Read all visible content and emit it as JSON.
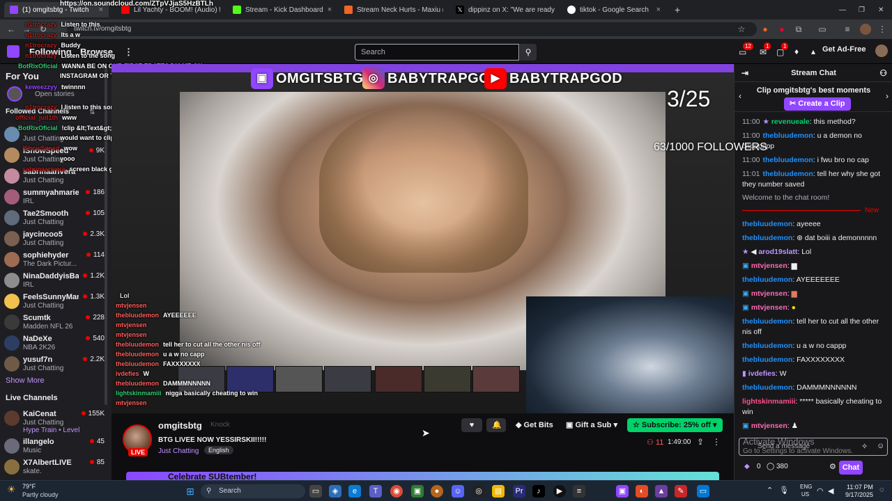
{
  "browser": {
    "tabs": [
      {
        "label": "(1) omgitsbtg - Twitch",
        "color": "#9146ff"
      },
      {
        "label": "Lil Yachty - BOOM! (Audio) ft. U",
        "color": "#ff0000"
      },
      {
        "label": "Stream - Kick Dashboard",
        "color": "#53fc18"
      },
      {
        "label": "Stream Neck Hurts - Maxiu (re",
        "color": "#f26522"
      },
      {
        "label": "dippinz on X: \"We are ready to",
        "color": "#ffffff"
      },
      {
        "label": "tiktok - Google Search",
        "color": "#4285f4"
      }
    ],
    "url": "twitch.tv/omgitsbtg",
    "new_tab": "+",
    "close": "×"
  },
  "topnav": {
    "following": "Following",
    "browse": "Browse",
    "search_placeholder": "Search",
    "notif_count_1": "12",
    "notif_count_2": "1",
    "notif_count_3": "1",
    "get_ad_free": "Get Ad-Free"
  },
  "sidebar": {
    "for_you": "For You",
    "open_stories": "Open stories",
    "followed_channels": "Followed Channels",
    "followed": [
      {
        "name": "",
        "category": "Just Chatting",
        "viewers": "",
        "color": "#6a8caf"
      },
      {
        "name": "IShowSpeed",
        "category": "Just Chatting",
        "viewers": "9K",
        "color": "#b58a5e"
      },
      {
        "name": "sabrinaarivera",
        "category": "Just Chatting",
        "viewers": "",
        "color": "#c48b9f"
      },
      {
        "name": "summyahmarie",
        "category": "IRL",
        "viewers": "186",
        "color": "#a35c7a"
      },
      {
        "name": "Tae2Smooth",
        "category": "Just Chatting",
        "viewers": "105",
        "color": "#5f6b7a"
      },
      {
        "name": "jaycincoo5",
        "category": "Just Chatting",
        "viewers": "2.3K",
        "color": "#7a6050"
      },
      {
        "name": "sophiehyder",
        "category": "The Dark Pictur...",
        "viewers": "114",
        "color": "#9e6b53"
      },
      {
        "name": "NinaDaddyisBa...",
        "category": "IRL",
        "viewers": "1.2K",
        "color": "#8d8d8d"
      },
      {
        "name": "FeelsSunnyMan",
        "category": "Just Chatting",
        "viewers": "1.3K",
        "color": "#f2c14e"
      },
      {
        "name": "Scumtk",
        "category": "Madden NFL 26",
        "viewers": "228",
        "color": "#3a3a3a"
      },
      {
        "name": "NaDeXe",
        "category": "NBA 2K26",
        "viewers": "540",
        "color": "#2d3e63"
      },
      {
        "name": "yusuf7n",
        "category": "Just Chatting",
        "viewers": "2.2K",
        "color": "#6f5a48"
      }
    ],
    "show_more": "Show More",
    "live_channels": "Live Channels",
    "live": [
      {
        "name": "KaiCenat",
        "category": "Just Chatting",
        "extra": "Hype Train • Level 22",
        "viewers": "155K",
        "color": "#5c3b2e"
      },
      {
        "name": "illangelo",
        "category": "Music",
        "extra": "",
        "viewers": "45",
        "color": "#6a6a7a"
      },
      {
        "name": "X7AlbertLIVE",
        "category": "skate.",
        "extra": "",
        "viewers": "85",
        "color": "#8a6f3e"
      }
    ]
  },
  "overlay_chat": {
    "soundcloud": "https://on.soundcloud.com/ZTpVJjaS5HzBTLh",
    "lines": [
      {
        "user": "n1trocrazy",
        "text": "Listen to this"
      },
      {
        "user": "n1trocrazy",
        "text": "Its a w"
      },
      {
        "user": "n1trocrazy",
        "text": "Buddy"
      },
      {
        "user": "n1trocrazy",
        "text": "Listen to the song"
      },
      {
        "user": "BotRixOficial",
        "text": "WANNA BE ON OUR FIRST EDATE? DM ME ON"
      },
      {
        "user": "",
        "text": "INSTAGRAM OR TWITTER !instagram !twitter"
      },
      {
        "user": "keweezzyy",
        "text": "twinnnn"
      },
      {
        "user": "n1trocrazy",
        "text": "I listen to this song everyday"
      },
      {
        "user": "official_jud1th",
        "text": "www"
      },
      {
        "user": "BotRixOficial",
        "text": "!clip &lt;Text&gt; then the number of seconds you"
      },
      {
        "user": "",
        "text": "would want to clip after"
      },
      {
        "user": "IShowSpeed",
        "text": "wow"
      },
      {
        "user": "",
        "text": "yooo"
      },
      {
        "user": "sabrinaarivera",
        "text": "screen black gang"
      }
    ]
  },
  "video": {
    "banner_twitch": "OMGITSBTG",
    "banner_ig": "BABYTRAPGOD",
    "banner_yt": "BABYTRAPGOD",
    "counter": "3/25",
    "followers_goal": "63/1000 FOLLOWERS",
    "mini_chat": [
      {
        "user": "",
        "text": "Lol",
        "color": "#9146ff"
      },
      {
        "user": "mtvjensen",
        "text": "",
        "color": "#ff5c5c"
      },
      {
        "user": "thebluudemon",
        "text": "AYEEEEEE",
        "color": "#ff5c5c"
      },
      {
        "user": "mtvjensen",
        "text": "",
        "color": "#ff5c5c"
      },
      {
        "user": "mtvjensen",
        "text": "",
        "color": "#ff5c5c"
      },
      {
        "user": "thebluudemon",
        "text": "tell her to cut all the other nis off",
        "color": "#ff5c5c"
      },
      {
        "user": "thebluudemon",
        "text": "u a w no capp",
        "color": "#ff5c5c"
      },
      {
        "user": "thebluudemon",
        "text": "FAXXXXXXX",
        "color": "#ff5c5c"
      },
      {
        "user": "ivdefies",
        "text": "W",
        "color": "#ff5c5c"
      },
      {
        "user": "thebluudemon",
        "text": "DAMMMNNNNN",
        "color": "#ff5c5c"
      },
      {
        "user": "lightskinmamiii",
        "text": "nigga basically cheating to win",
        "color": "#ff5c5c"
      },
      {
        "user": "mtvjensen",
        "text": "",
        "color": "#ff5c5c"
      }
    ]
  },
  "stream_info": {
    "streamer": "omgitsbtg",
    "knock": "Knock",
    "title": "BTG LIVEE NOW YESSIRSKII!!!!!",
    "category": "Just Chatting",
    "tag": "English",
    "live": "LIVE",
    "get_bits": "Get Bits",
    "gift_sub": "Gift a Sub",
    "subscribe": "Subscribe: 25% off",
    "viewers": "11",
    "uptime": "1:49:00",
    "celebrate": "Celebrate SUBtember!"
  },
  "chat": {
    "header": "Stream Chat",
    "clip_title": "Clip omgitsbtg's best moments",
    "clip_button": "Create a Clip",
    "welcome": "Welcome to the chat room!",
    "new_label": "New",
    "older": [
      {
        "time": "11:00",
        "user": "revenueale",
        "text": "this method?",
        "color": "#00d26a"
      },
      {
        "time": "11:00",
        "user": "thebluudemon",
        "text": "u a demon no capppppp",
        "color": "#1e90ff"
      },
      {
        "time": "11:00",
        "user": "thebluudemon",
        "text": "i fwu bro no cap",
        "color": "#1e90ff"
      },
      {
        "time": "11:01",
        "user": "thebluudemon",
        "text": "tell her why she got they number saved",
        "color": "#1e90ff"
      }
    ],
    "messages": [
      {
        "user": "thebluudemon",
        "text": "ayeeee",
        "color": "#1e90ff"
      },
      {
        "user": "thebluudemon",
        "text": "dat boiii a demonnnnn",
        "color": "#1e90ff"
      },
      {
        "user": "arod19slatt",
        "text": "Lol",
        "color": "#bf94ff"
      },
      {
        "user": "mtvjensen",
        "text": "",
        "color": "#ff69b4"
      },
      {
        "user": "thebluudemon",
        "text": "AYEEEEEEE",
        "color": "#1e90ff"
      },
      {
        "user": "mtvjensen",
        "text": "",
        "color": "#ff69b4"
      },
      {
        "user": "mtvjensen",
        "text": "",
        "color": "#ff69b4"
      },
      {
        "user": "thebluudemon",
        "text": "tell her to cut all the other nis off",
        "color": "#1e90ff"
      },
      {
        "user": "thebluudemon",
        "text": "u a w no cappp",
        "color": "#1e90ff"
      },
      {
        "user": "thebluudemon",
        "text": "FAXXXXXXXX",
        "color": "#1e90ff"
      },
      {
        "user": "ivdefies",
        "text": "W",
        "color": "#bf94ff"
      },
      {
        "user": "thebluudemon",
        "text": "DAMMMNNNNNN",
        "color": "#1e90ff"
      },
      {
        "user": "lightskinmamiii",
        "text": "***** basically cheating to win",
        "color": "#ff4f8b"
      },
      {
        "user": "mtvjensen",
        "text": "",
        "color": "#ff69b4"
      }
    ],
    "send_placeholder": "Send a message",
    "bits": "0",
    "points": "380",
    "chat_button": "Chat",
    "activate_1": "Activate Windows",
    "activate_2": "Go to Settings to activate Windows."
  },
  "taskbar": {
    "weather_temp": "79°F",
    "weather_desc": "Partly cloudy",
    "search": "Search",
    "lang": "ENG",
    "region": "US",
    "time": "11:07 PM",
    "date": "9/17/2025"
  }
}
